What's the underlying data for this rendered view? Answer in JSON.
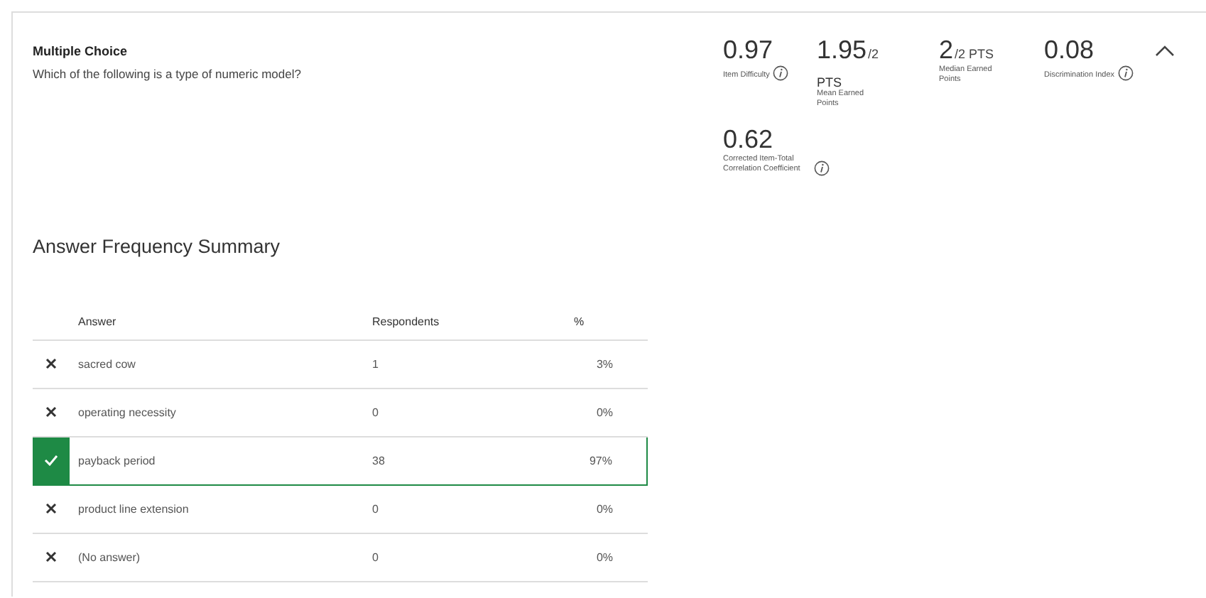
{
  "question": {
    "type": "Multiple Choice",
    "text": "Which of the following is a type of numeric model?"
  },
  "stats": [
    {
      "value": "0.97",
      "label": "Item Difficulty",
      "info": true
    },
    {
      "value": "1.95",
      "suffix": "/2",
      "unit": "PTS",
      "label": "Mean Earned Points",
      "info": false
    },
    {
      "value": "2",
      "suffix": "/2 PTS",
      "label": "Median Earned Points",
      "info": false
    },
    {
      "value": "0.08",
      "label": "Discrimination Index",
      "info": true
    },
    {
      "value": "0.62",
      "label": "Corrected Item-Total Correlation Coefficient",
      "info": true
    }
  ],
  "collapse": {
    "expanded": true
  },
  "summary": {
    "title": "Answer Frequency Summary",
    "columns": [
      "Answer",
      "Respondents",
      "%"
    ],
    "rows": [
      {
        "answer": "sacred cow",
        "respondents": "1",
        "percent": "3%",
        "correct": false
      },
      {
        "answer": "operating necessity",
        "respondents": "0",
        "percent": "0%",
        "correct": false
      },
      {
        "answer": "payback period",
        "respondents": "38",
        "percent": "97%",
        "correct": true
      },
      {
        "answer": "product line extension",
        "respondents": "0",
        "percent": "0%",
        "correct": false
      },
      {
        "answer": "(No answer)",
        "respondents": "0",
        "percent": "0%",
        "correct": false
      }
    ]
  }
}
